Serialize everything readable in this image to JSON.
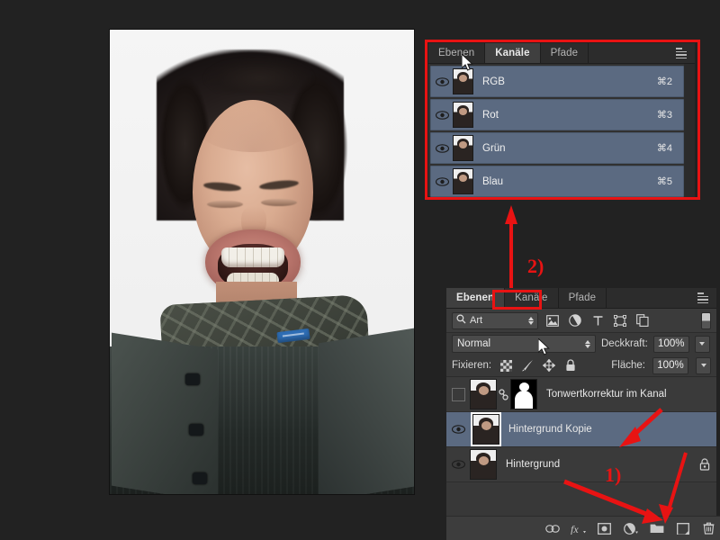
{
  "app": {
    "title": "Adobe Photoshop panels",
    "background_color": "#222222",
    "accent_selection_color": "#5b6a81",
    "annotation_color": "#e81313"
  },
  "document_image": {
    "alt": "Portrait photo of a young man with dark tousled hair, eyes closed, mouth distorted open showing teeth, wearing a grey checked scarf and a dark wool coat on a white background"
  },
  "channels_panel": {
    "tabs": [
      {
        "label": "Ebenen",
        "active": false
      },
      {
        "label": "Kanäle",
        "active": true
      },
      {
        "label": "Pfade",
        "active": false
      }
    ],
    "menu_icon": "panel-menu-icon",
    "rows": [
      {
        "name": "RGB",
        "shortcut": "⌘2",
        "visible": true,
        "selected": true
      },
      {
        "name": "Rot",
        "shortcut": "⌘3",
        "visible": true,
        "selected": true
      },
      {
        "name": "Grün",
        "shortcut": "⌘4",
        "visible": true,
        "selected": true
      },
      {
        "name": "Blau",
        "shortcut": "⌘5",
        "visible": true,
        "selected": true
      }
    ]
  },
  "layers_panel": {
    "tabs": [
      {
        "label": "Ebenen",
        "active": true
      },
      {
        "label": "Kanäle",
        "active": false
      },
      {
        "label": "Pfade",
        "active": false
      }
    ],
    "menu_icon": "panel-menu-icon",
    "filter": {
      "search_icon": "search-icon",
      "kind_value": "Art",
      "icons": [
        "image-filter-icon",
        "adjustment-filter-icon",
        "text-filter-icon",
        "shape-filter-icon",
        "smart-object-filter-icon"
      ],
      "toggle_icon": "filter-toggle-switch"
    },
    "blend": {
      "mode": "Normal",
      "opacity_label": "Deckkraft:",
      "opacity_value": "100%"
    },
    "lock": {
      "label": "Fixieren:",
      "icons": [
        "lock-transparency-icon",
        "lock-image-pixels-icon",
        "lock-position-icon",
        "lock-all-icon"
      ],
      "fill_label": "Fläche:",
      "fill_value": "100%"
    },
    "layers": [
      {
        "name": "Tonwertkorrektur im Kanal",
        "visible": false,
        "selected": false,
        "has_mask": true,
        "has_link": true,
        "locked": false
      },
      {
        "name": "Hintergrund Kopie",
        "visible": true,
        "selected": true,
        "has_mask": false,
        "has_link": false,
        "locked": false
      },
      {
        "name": "Hintergrund",
        "visible": true,
        "selected": false,
        "has_mask": false,
        "has_link": false,
        "locked": true
      }
    ],
    "bottom_bar_icons": [
      "link-layers-icon",
      "layer-style-fx-icon",
      "add-layer-mask-icon",
      "new-adjustment-layer-icon",
      "new-group-icon",
      "new-layer-icon",
      "delete-layer-icon"
    ]
  },
  "annotations": {
    "step_one": "1)",
    "step_two": "2)"
  }
}
